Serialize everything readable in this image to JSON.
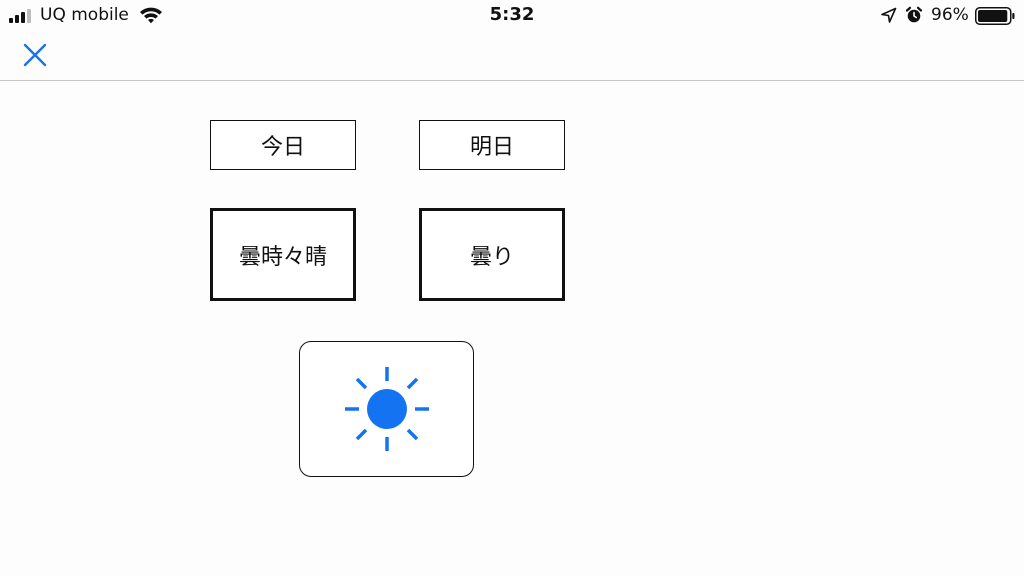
{
  "status_bar": {
    "carrier": "UQ mobile",
    "time": "5:32",
    "battery_percent": "96%",
    "battery_level": 0.96,
    "signal_bars": 3,
    "icons": [
      "signal-icon",
      "wifi-icon",
      "location-icon",
      "alarm-icon",
      "battery-icon"
    ]
  },
  "nav": {
    "close_icon": "close-icon",
    "accent_color": "#1a73e8"
  },
  "days": {
    "today": "今日",
    "tomorrow": "明日"
  },
  "forecast": {
    "today": "曇時々晴",
    "tomorrow": "曇り"
  },
  "weather_icon": {
    "name": "sun-icon",
    "color": "#1473f0"
  }
}
